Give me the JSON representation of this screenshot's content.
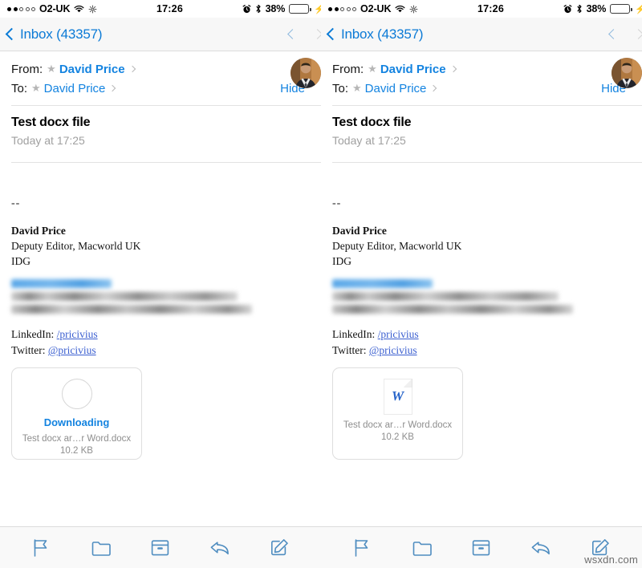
{
  "status_bar": {
    "carrier": "O2-UK",
    "time": "17:26",
    "battery_percent": "38%",
    "signal_dots_filled": 2,
    "signal_dots_total": 5,
    "wifi_icon": "wifi-icon",
    "sync_icon": "sync-icon",
    "alarm_icon": "alarm-clock-icon",
    "bluetooth_icon": "bluetooth-icon",
    "charging_icon": "charging-bolt-icon",
    "battery_fill_color": "#4cd964"
  },
  "nav_bar": {
    "back_label": "Inbox (43357)",
    "back_icon": "chevron-left-icon",
    "prev_icon": "chevron-up-icon",
    "next_icon": "chevron-down-icon",
    "accent_color": "#0b7ad6"
  },
  "message_header": {
    "from_label": "From:",
    "from_name": "David Price",
    "to_label": "To:",
    "to_name": "David Price",
    "hide_label": "Hide",
    "star_icon": "star-icon",
    "disclosure_icon": "chevron-right-icon",
    "avatar_name": "contact-avatar"
  },
  "message": {
    "subject": "Test docx file",
    "date": "Today at 17:25",
    "signature_separator": "--",
    "signature_name": "David Price",
    "signature_title": "Deputy Editor, Macworld UK",
    "signature_company": "IDG",
    "redacted_lines": 3,
    "linkedin_label": "LinkedIn:",
    "linkedin_handle": "/pricivius",
    "twitter_label": "Twitter:",
    "twitter_handle": "@pricivius"
  },
  "attachment_left": {
    "state_label": "Downloading",
    "filename": "Test docx ar…r Word.docx",
    "filesize": "10.2 KB",
    "icon": "progress-ring-icon"
  },
  "attachment_right": {
    "filename": "Test docx ar…r Word.docx",
    "filesize": "10.2 KB",
    "icon": "word-document-icon",
    "icon_letter": "W"
  },
  "toolbar": {
    "flag_label": "flag-icon",
    "folder_label": "folder-icon",
    "archive_label": "archive-icon",
    "reply_label": "reply-icon",
    "compose_label": "compose-icon",
    "icon_color": "#4f8dc0"
  },
  "watermark": "wsxdn.com"
}
